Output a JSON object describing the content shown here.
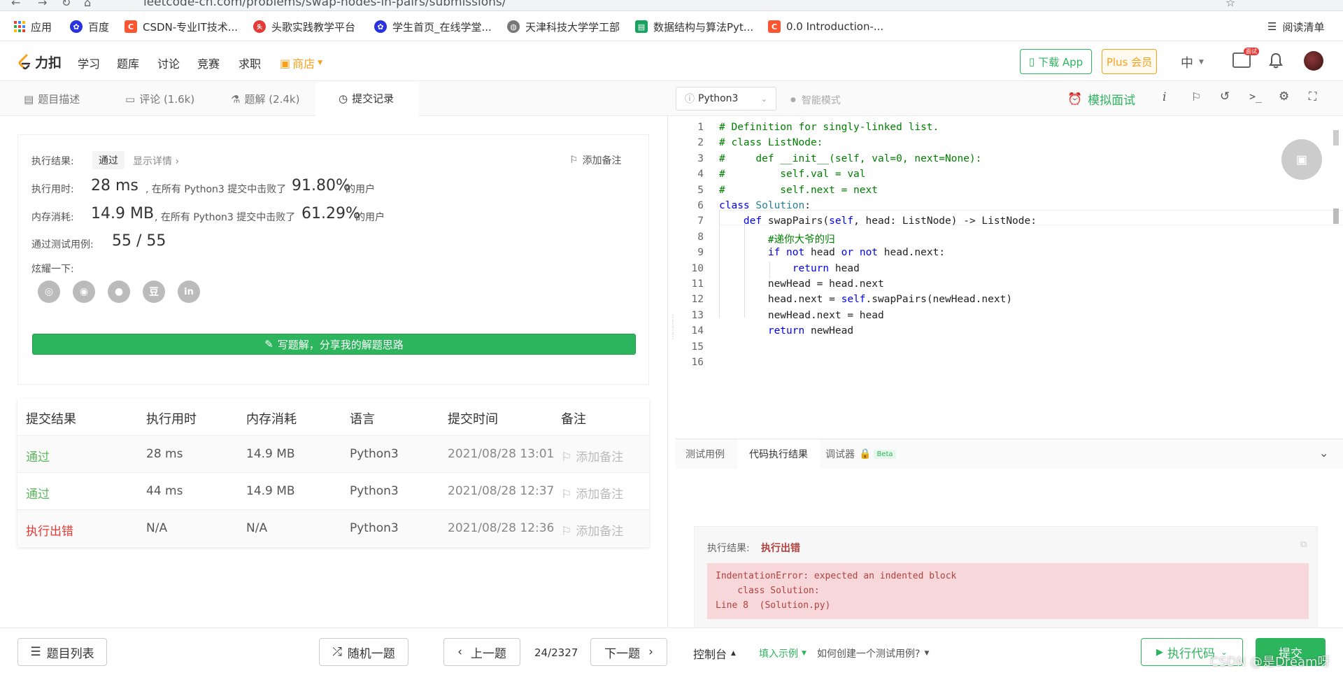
{
  "browser": {
    "url": "leetcode-cn.com/problems/swap-nodes-in-pairs/submissions/",
    "bookmarks": [
      {
        "label": "应用",
        "icon": "apps-grid-icon",
        "color": "#4285f4"
      },
      {
        "label": "百度",
        "icon": "baidu-paw-icon",
        "color": "#2932e1"
      },
      {
        "label": "CSDN-专业IT技术...",
        "icon": "csdn-c-icon",
        "color": "#fc5531"
      },
      {
        "label": "头歌实践教学平台",
        "icon": "educoder-icon",
        "color": "#e53935"
      },
      {
        "label": "学生首页_在线学堂...",
        "icon": "paw-icon",
        "color": "#2932e1"
      },
      {
        "label": "天津科技大学学工部",
        "icon": "globe-icon",
        "color": "#777777"
      },
      {
        "label": "数据结构与算法Pyt...",
        "icon": "book-icon",
        "color": "#1aa260"
      },
      {
        "label": "0.0 Introduction-...",
        "icon": "csdn-c-icon",
        "color": "#fc5531"
      }
    ],
    "reading_list": "阅读清单"
  },
  "header": {
    "logo": "力扣",
    "nav": [
      "学习",
      "题库",
      "讨论",
      "竞赛",
      "求职"
    ],
    "shop": "商店",
    "download_app": "下载 App",
    "plus": "Plus 会员",
    "lang": "中",
    "badge": "面试"
  },
  "tabs": [
    {
      "label": "题目描述",
      "icon": "document-icon"
    },
    {
      "label": "评论 (1.6k)",
      "icon": "comment-icon"
    },
    {
      "label": "题解 (2.4k)",
      "icon": "flask-icon"
    },
    {
      "label": "提交记录",
      "icon": "clock-icon"
    }
  ],
  "editor_bar": {
    "language": "Python3",
    "smart_mode": "智能模式",
    "mock_interview": "模拟面试"
  },
  "result": {
    "status_label": "执行结果:",
    "status": "通过",
    "details": "显示详情 ›",
    "add_note": "添加备注",
    "runtime_label": "执行用时:",
    "runtime": "28 ms",
    "runtime_text": ", 在所有 Python3 提交中击败了",
    "runtime_pct": "91.80%",
    "users": "的用户",
    "memory_label": "内存消耗:",
    "memory": "14.9 MB",
    "memory_text": ", 在所有 Python3 提交中击败了",
    "memory_pct": "61.29%",
    "tests_label": "通过测试用例:",
    "tests": "55 / 55",
    "share_label": "炫耀一下:",
    "share_icons": [
      "wechat-icon",
      "weibo-icon",
      "qq-icon",
      "douban-icon",
      "linkedin-icon"
    ],
    "write_solution": "写题解，分享我的解题思路"
  },
  "submissions": {
    "headers": [
      "提交结果",
      "执行用时",
      "内存消耗",
      "语言",
      "提交时间",
      "备注"
    ],
    "rows": [
      {
        "status": "通过",
        "status_color": "#5cb85c",
        "time": "28 ms",
        "memory": "14.9 MB",
        "lang": "Python3",
        "date": "2021/08/28 13:01",
        "note": "添加备注"
      },
      {
        "status": "通过",
        "status_color": "#5cb85c",
        "time": "44 ms",
        "memory": "14.9 MB",
        "lang": "Python3",
        "date": "2021/08/28 12:37",
        "note": "添加备注"
      },
      {
        "status": "执行出错",
        "status_color": "#e53935",
        "time": "N/A",
        "memory": "N/A",
        "lang": "Python3",
        "date": "2021/08/28 12:36",
        "note": "添加备注"
      }
    ]
  },
  "code_lines": [
    "# Definition for singly-linked list.",
    "# class ListNode:",
    "#     def __init__(self, val=0, next=None):",
    "#         self.val = val",
    "#         self.next = next",
    "class Solution:",
    "    def swapPairs(self, head: ListNode) -> ListNode:",
    "        #递你大爷的归",
    "        if not head or not head.next:",
    "            return head",
    "        newHead = head.next",
    "        head.next = self.swapPairs(newHead.next)",
    "        newHead.next = head",
    "        return newHead",
    "",
    ""
  ],
  "output_panel": {
    "tabs": [
      "测试用例",
      "代码执行结果",
      "调试器"
    ],
    "beta": "Beta",
    "result_label": "执行结果:",
    "result": "执行出错",
    "error": "IndentationError: expected an indented block\n    class Solution:\nLine 8  (Solution.py)"
  },
  "footer": {
    "problem_list": "题目列表",
    "random": "随机一题",
    "prev": "上一题",
    "page": "24/2327",
    "next": "下一题",
    "console": "控制台",
    "fill_example": "填入示例",
    "how_to": "如何创建一个测试用例?",
    "run": "执行代码",
    "submit": "提交",
    "watermark": "CSDN @是Dream呀"
  }
}
